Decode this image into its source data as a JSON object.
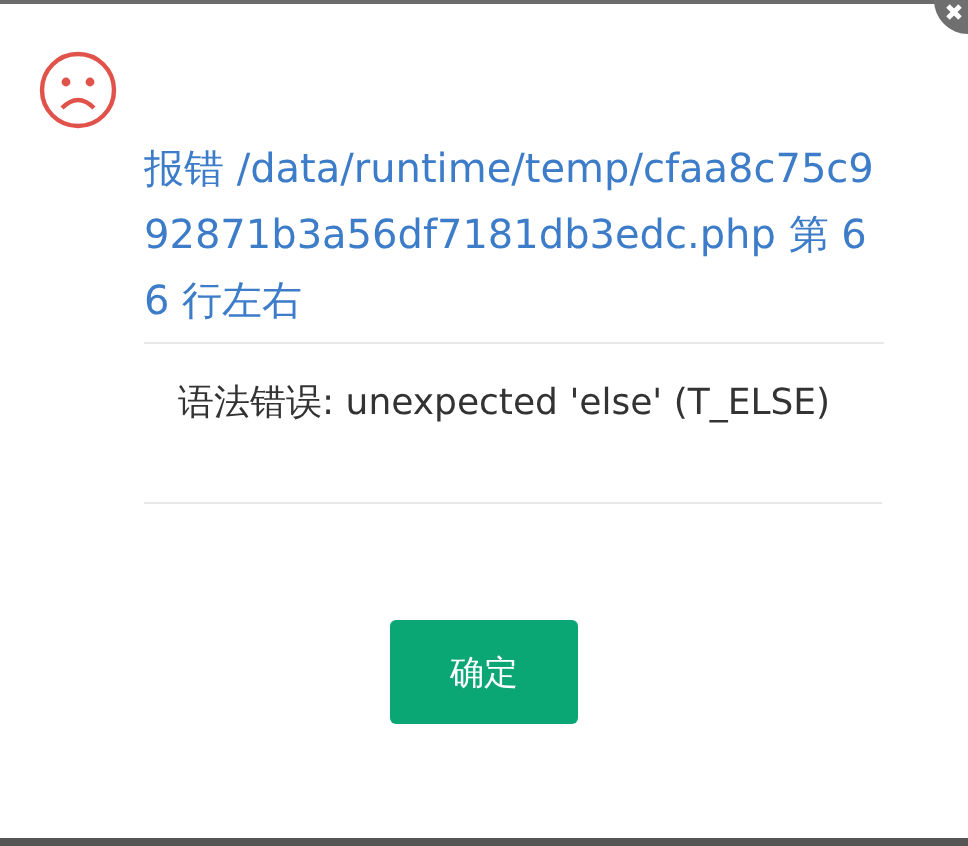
{
  "dialog": {
    "title": "报错 /data/runtime/temp/cfaa8c75c992871b3a56df7181db3edc.php 第 66 行左右",
    "message": "语法错误: unexpected 'else' (T_ELSE)",
    "buttons": [
      "确定"
    ]
  }
}
